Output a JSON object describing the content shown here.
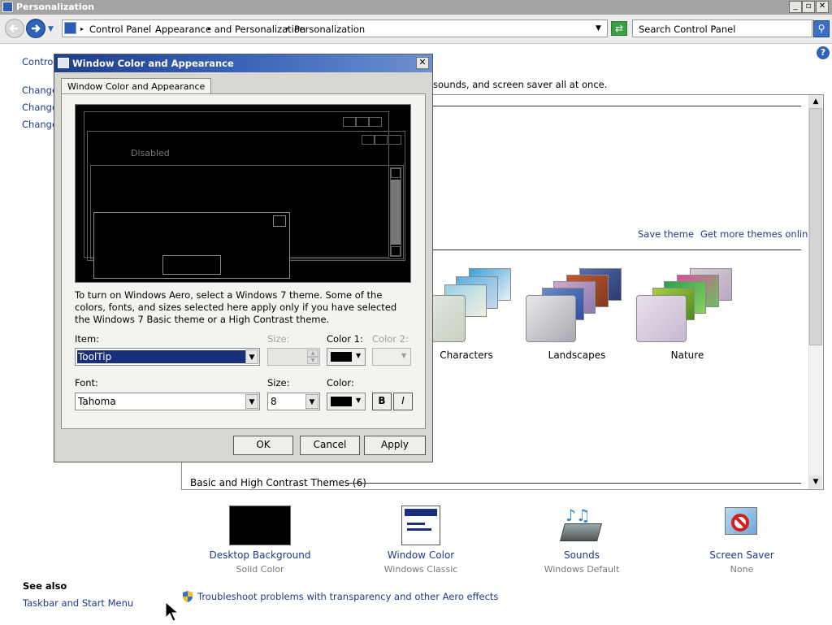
{
  "window": {
    "title": "Personalization"
  },
  "address": {
    "crumbs": [
      "Control Panel",
      "Appearance and Personalization",
      "Personalization"
    ]
  },
  "search": {
    "placeholder": "Search Control Panel"
  },
  "left_panel": {
    "items": [
      "Control",
      "Change",
      "Change",
      "Change"
    ],
    "see_also": "See also",
    "taskbar_link": "Taskbar and Start Menu"
  },
  "main": {
    "intro_fragment": "sounds, and screen saver all at once.",
    "save_theme": "Save theme",
    "get_more": "Get more themes online",
    "themes": [
      "Characters",
      "Landscapes",
      "Nature"
    ],
    "basic_group": "Basic and High Contrast Themes (6)"
  },
  "bottom": [
    {
      "label": "Desktop Background",
      "sub": "Solid Color"
    },
    {
      "label": "Window Color",
      "sub": "Windows Classic"
    },
    {
      "label": "Sounds",
      "sub": "Windows Default"
    },
    {
      "label": "Screen Saver",
      "sub": "None"
    }
  ],
  "troubleshoot": "Troubleshoot problems with transparency and other Aero effects",
  "dialog": {
    "title": "Window Color and Appearance",
    "tab": "Window Color and Appearance",
    "preview_disabled": "Disabled",
    "description": "To turn on Windows Aero, select a Windows 7 theme.  Some of the colors, fonts, and sizes selected here apply only if you have selected the Windows 7 Basic theme or a High Contrast theme.",
    "item_label": "Item:",
    "item_value": "ToolTip",
    "size_label": "Size:",
    "color1_label": "Color 1:",
    "color2_label": "Color 2:",
    "font_label": "Font:",
    "font_value": "Tahoma",
    "font_size_label": "Size:",
    "font_size_value": "8",
    "font_color_label": "Color:",
    "bold": "B",
    "italic": "I",
    "ok": "OK",
    "cancel": "Cancel",
    "apply": "Apply"
  },
  "colors": {
    "link": "#1e3a8a",
    "selection": "#1a2f7a",
    "title_gradient": "#1f3d8a"
  }
}
